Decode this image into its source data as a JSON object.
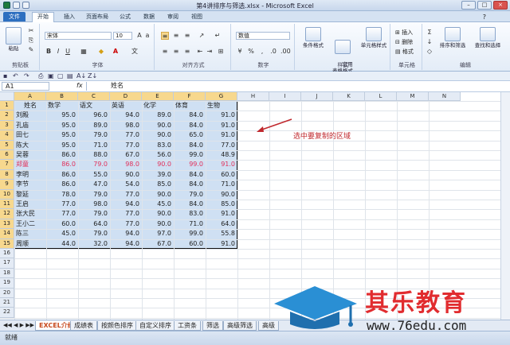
{
  "window": {
    "title": "第4讲排序与筛选.xlsx - Microsoft Excel"
  },
  "ribbon_tabs": [
    "文件",
    "开始",
    "插入",
    "页面布局",
    "公式",
    "数据",
    "审阅",
    "视图"
  ],
  "ribbon": {
    "clipboard": {
      "paste": "粘贴",
      "label": "剪贴板"
    },
    "font": {
      "name": "宋体",
      "size": "10",
      "label": "字体"
    },
    "alignment": {
      "label": "对齐方式"
    },
    "number": {
      "format": "数值",
      "label": "数字"
    },
    "styles": {
      "cond": "条件格式",
      "table": "套用\n表格格式",
      "cell": "单元格样式",
      "label": "样式"
    },
    "cells": {
      "insert": "插入",
      "delete": "删除",
      "format": "格式",
      "label": "单元格"
    },
    "editing": {
      "sort": "排序和筛选",
      "find": "查找和选择",
      "label": "编辑"
    }
  },
  "formula_bar": {
    "name_box": "A1",
    "fx": "fx",
    "content": "姓名"
  },
  "columns": [
    "A",
    "B",
    "C",
    "D",
    "E",
    "F",
    "G",
    "H",
    "I",
    "J",
    "K",
    "L",
    "M",
    "N"
  ],
  "header_row": [
    "姓名",
    "数学",
    "语文",
    "英语",
    "化学",
    "体育",
    "生物"
  ],
  "rows": [
    {
      "name": "刘殿",
      "vals": [
        "95.0",
        "96.0",
        "94.0",
        "89.0",
        "84.0",
        "91.0"
      ]
    },
    {
      "name": "孔庙",
      "vals": [
        "95.0",
        "89.0",
        "98.0",
        "90.0",
        "84.0",
        "91.0"
      ]
    },
    {
      "name": "田七",
      "vals": [
        "95.0",
        "79.0",
        "77.0",
        "90.0",
        "65.0",
        "91.0"
      ]
    },
    {
      "name": "陈大",
      "vals": [
        "95.0",
        "71.0",
        "77.0",
        "83.0",
        "84.0",
        "77.0"
      ]
    },
    {
      "name": "吴蓉",
      "vals": [
        "86.0",
        "88.0",
        "67.0",
        "56.0",
        "99.0",
        "48.9"
      ]
    },
    {
      "name": "郑童",
      "vals": [
        "86.0",
        "79.0",
        "98.0",
        "90.0",
        "99.0",
        "91.0"
      ],
      "red": true
    },
    {
      "name": "李明",
      "vals": [
        "86.0",
        "55.0",
        "90.0",
        "39.0",
        "84.0",
        "60.0"
      ]
    },
    {
      "name": "李节",
      "vals": [
        "86.0",
        "47.0",
        "54.0",
        "85.0",
        "84.0",
        "71.0"
      ]
    },
    {
      "name": "黎延",
      "vals": [
        "78.0",
        "79.0",
        "77.0",
        "90.0",
        "79.0",
        "90.0"
      ]
    },
    {
      "name": "王启",
      "vals": [
        "77.0",
        "98.0",
        "94.0",
        "45.0",
        "84.0",
        "85.0"
      ]
    },
    {
      "name": "张大民",
      "vals": [
        "77.0",
        "79.0",
        "77.0",
        "90.0",
        "83.0",
        "91.0"
      ]
    },
    {
      "name": "王小二",
      "vals": [
        "60.0",
        "64.0",
        "77.0",
        "90.0",
        "71.0",
        "64.0"
      ]
    },
    {
      "name": "陈三",
      "vals": [
        "45.0",
        "79.0",
        "94.0",
        "97.0",
        "99.0",
        "55.8"
      ]
    },
    {
      "name": "周顺",
      "vals": [
        "44.0",
        "32.0",
        "94.0",
        "67.0",
        "60.0",
        "91.0"
      ]
    }
  ],
  "annotation": "选中要复制的区域",
  "sheet_tabs": [
    "EXCEL介绍",
    "成绩表",
    "按颜色排序",
    "自定义排序",
    "工资条",
    "筛选",
    "高级筛选",
    "高级"
  ],
  "status": "就绪",
  "watermark": {
    "brand": "其乐教育",
    "url": "www.76edu.com"
  },
  "colors": {
    "selection": "#cfe0f3",
    "highlight_row": "#e2315a",
    "annotation": "#c0282d",
    "file_tab": "#2d6fc0"
  }
}
